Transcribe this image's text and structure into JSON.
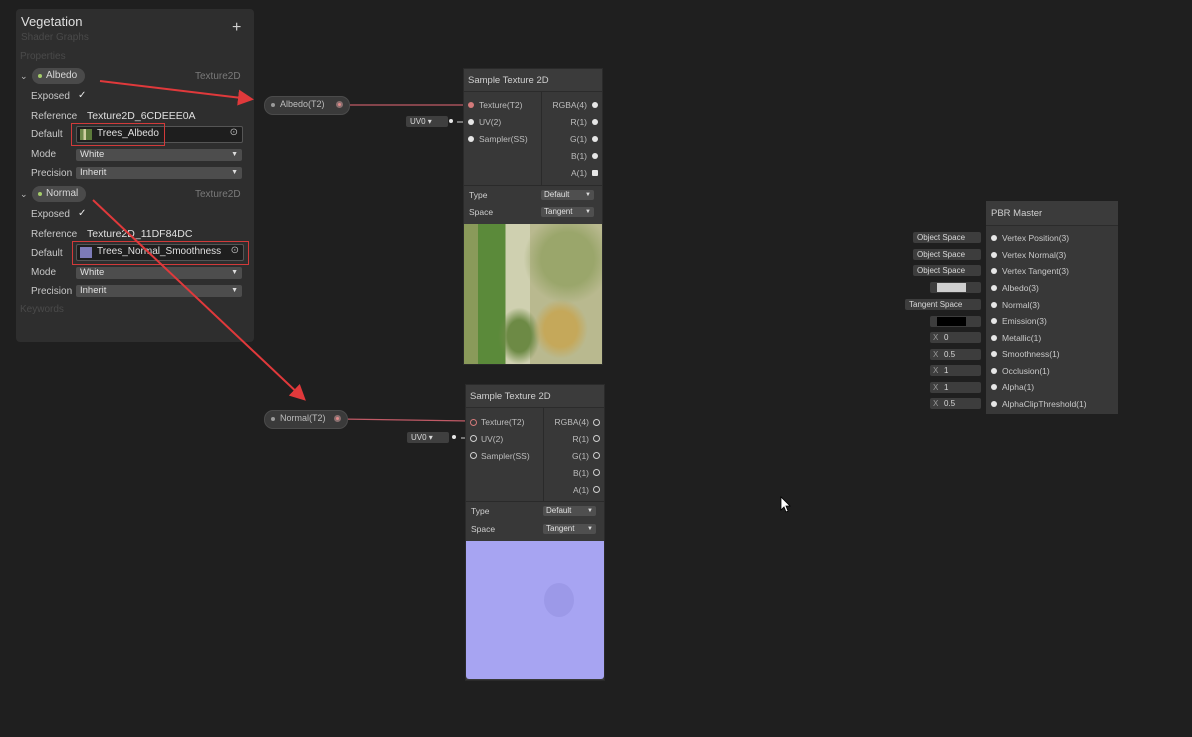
{
  "blackboard": {
    "title": "Vegetation",
    "subtitle": "Shader Graphs",
    "add_icon": "+",
    "properties_label": "Properties",
    "keywords_label": "Keywords",
    "props": [
      {
        "name": "Albedo",
        "type": "Texture2D",
        "exposed_label": "Exposed",
        "exposed_check": "✓",
        "reference_label": "Reference",
        "reference_value": "Texture2D_6CDEEE0A",
        "default_label": "Default",
        "default_value": "Trees_Albedo",
        "mode_label": "Mode",
        "mode_value": "White",
        "precision_label": "Precision",
        "precision_value": "Inherit"
      },
      {
        "name": "Normal",
        "type": "Texture2D",
        "exposed_label": "Exposed",
        "exposed_check": "✓",
        "reference_label": "Reference",
        "reference_value": "Texture2D_11DF84DC",
        "default_label": "Default",
        "default_value": "Trees_Normal_Smoothness",
        "mode_label": "Mode",
        "mode_value": "White",
        "precision_label": "Precision",
        "precision_value": "Inherit"
      }
    ]
  },
  "property_nodes": [
    {
      "label": "Albedo(T2)"
    },
    {
      "label": "Normal(T2)"
    }
  ],
  "sample_nodes": [
    {
      "title": "Sample Texture 2D",
      "uv_default": "UV0",
      "inputs": [
        "Texture(T2)",
        "UV(2)",
        "Sampler(SS)"
      ],
      "outputs": [
        "RGBA(4)",
        "R(1)",
        "G(1)",
        "B(1)",
        "A(1)"
      ],
      "type_label": "Type",
      "type_value": "Default",
      "space_label": "Space",
      "space_value": "Tangent"
    },
    {
      "title": "Sample Texture 2D",
      "uv_default": "UV0",
      "inputs": [
        "Texture(T2)",
        "UV(2)",
        "Sampler(SS)"
      ],
      "outputs": [
        "RGBA(4)",
        "R(1)",
        "G(1)",
        "B(1)",
        "A(1)"
      ],
      "type_label": "Type",
      "type_value": "Default",
      "space_label": "Space",
      "space_value": "Tangent"
    }
  ],
  "pbr_master": {
    "title": "PBR Master",
    "ports": [
      {
        "label": "Vertex Position(3)",
        "input": "Object Space"
      },
      {
        "label": "Vertex Normal(3)",
        "input": "Object Space"
      },
      {
        "label": "Vertex Tangent(3)",
        "input": "Object Space"
      },
      {
        "label": "Albedo(3)",
        "input": ""
      },
      {
        "label": "Normal(3)",
        "input": "Tangent Space"
      },
      {
        "label": "Emission(3)",
        "input": ""
      },
      {
        "label": "Metallic(1)",
        "input_x": "X",
        "input_value": "0"
      },
      {
        "label": "Smoothness(1)",
        "input_x": "X",
        "input_value": "0.5"
      },
      {
        "label": "Occlusion(1)",
        "input_x": "X",
        "input_value": "1"
      },
      {
        "label": "Alpha(1)",
        "input_x": "X",
        "input_value": "1"
      },
      {
        "label": "AlphaClipThreshold(1)",
        "input_x": "X",
        "input_value": "0.5"
      }
    ],
    "albedo_swatch": "#cfcfcf",
    "emission_swatch": "#000000"
  },
  "colors": {
    "annotation_red": "#e0393b",
    "edge": "#c05a66",
    "normal_map": "#a7a4f2"
  }
}
